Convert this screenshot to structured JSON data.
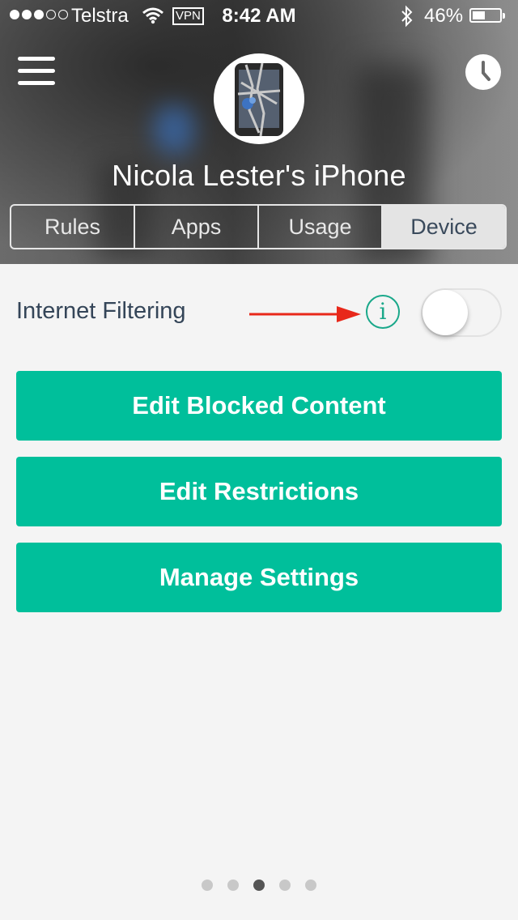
{
  "status_bar": {
    "carrier": "Telstra",
    "vpn": "VPN",
    "time": "8:42 AM",
    "battery": "46%",
    "battery_level": 0.46
  },
  "header": {
    "menu_icon": "hamburger-menu-icon",
    "history_icon": "clock-icon",
    "device_name": "Nicola Lester's iPhone"
  },
  "tabs": [
    {
      "label": "Rules",
      "active": false
    },
    {
      "label": "Apps",
      "active": false
    },
    {
      "label": "Usage",
      "active": false
    },
    {
      "label": "Device",
      "active": true
    }
  ],
  "filtering": {
    "label": "Internet Filtering",
    "info_glyph": "i",
    "toggle_on": false
  },
  "buttons": {
    "edit_blocked": "Edit Blocked Content",
    "edit_restrictions": "Edit Restrictions",
    "manage_settings": "Manage Settings"
  },
  "pager": {
    "count": 5,
    "active_index": 2
  },
  "colors": {
    "accent": "#00bf9b",
    "arrow": "#e8281a",
    "text_dark": "#344558"
  }
}
